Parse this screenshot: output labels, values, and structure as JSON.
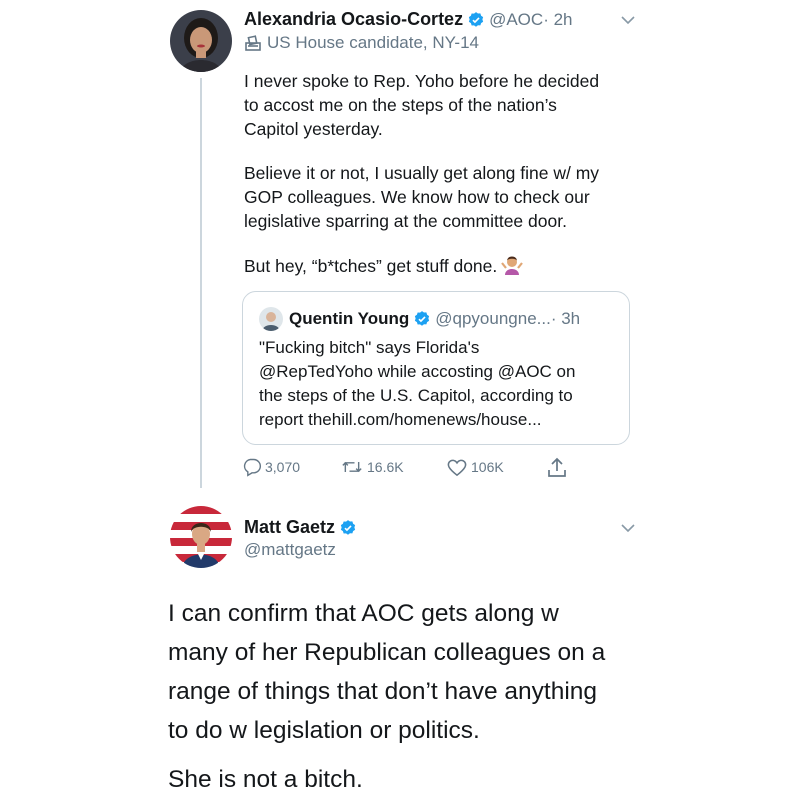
{
  "colors": {
    "text": "#14171a",
    "secondary": "#657786",
    "verified": "#1da1f2",
    "border": "#ccd6dd"
  },
  "tweet1": {
    "display_name": "Alexandria Ocasio-Cortez",
    "handle": "@AOC",
    "time": " · 2h",
    "label": "US House candidate, NY-14",
    "label_icon": "ballot-box-icon",
    "paragraphs": [
      "I never spoke to Rep. Yoho before he decided\nto accost me on the steps of the nation’s\nCapitol yesterday.",
      "Believe it or not, I usually get along fine w/ my\nGOP colleagues. We know how to check our\nlegislative sparring at the committee door.",
      "But hey, “b*tches” get stuff done."
    ],
    "emoji": "person-shrugging-emoji",
    "quote": {
      "display_name": "Quentin Young",
      "handle": "@qpyoungne...",
      "time": " · 3h",
      "text": "\"Fucking bitch\" says Florida's\n@RepTedYoho while accosting @AOC on\nthe steps of the U.S. Capitol, according to\nreport thehill.com/homenews/house..."
    },
    "actions": {
      "replies": "3,070",
      "retweets": "16.6K",
      "likes": "106K"
    }
  },
  "tweet2": {
    "display_name": "Matt Gaetz",
    "handle": "@mattgaetz",
    "paragraphs": [
      "I can confirm that AOC gets along w\nmany of her Republican colleagues on a\nrange of things that don’t have anything\nto do w legislation or politics.",
      "She is not a bitch."
    ]
  }
}
